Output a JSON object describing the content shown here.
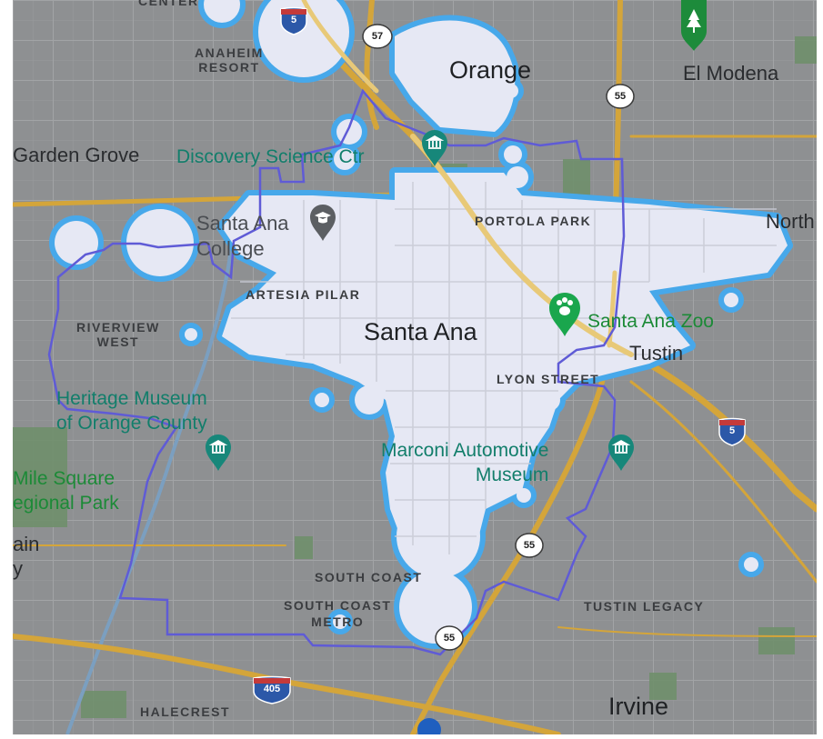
{
  "map": {
    "labels": {
      "center": "CENTER",
      "anaheim_resort": "ANAHEIM\nRESORT",
      "orange": "Orange",
      "el_modena": "El Modena",
      "garden_grove": "Garden Grove",
      "discovery_science_ctr": "Discovery Science Ctr",
      "santa_ana_college": "Santa Ana\nCollege",
      "portola_park": "PORTOLA PARK",
      "north": "North",
      "artesia_pilar": "ARTESIA PILAR",
      "riverview_west": "RIVERVIEW\nWEST",
      "santa_ana": "Santa Ana",
      "santa_ana_zoo": "Santa Ana Zoo",
      "tustin": "Tustin",
      "lyon_street": "LYON STREET",
      "heritage_museum": "Heritage Museum\nof Orange County",
      "marconi_museum": "Marconi Automotive\nMuseum",
      "mile_square": "Mile Square\negional Park",
      "ain": "ain",
      "y": "y",
      "south_coast": "SOUTH COAST",
      "south_coast_metro": "SOUTH COAST\nMETRO",
      "tustin_legacy": "TUSTIN LEGACY",
      "halecrest": "HALECREST",
      "irvine": "Irvine"
    },
    "shields": {
      "i5_north": "5",
      "i5_east": "5",
      "ca57": "57",
      "ca55_north": "55",
      "ca55_south": "55",
      "ca55_bottom": "55",
      "i405": "405"
    },
    "colors": {
      "background": "#8e9092",
      "street": "#a7a9ab",
      "highway": "#d4a53a",
      "coverage_fill": "#e6e8f4",
      "coverage_outline": "#47a8ea",
      "boundary": "#5f5bd6",
      "water": "#7b9fc0",
      "park": "#6b8f6a",
      "poi_museum": "#17877a",
      "poi_zoo": "#1aa64d"
    },
    "icons": {
      "tree": "tree-icon",
      "museum": "museum-icon",
      "college": "graduation-cap-icon",
      "zoo": "paw-icon"
    }
  }
}
